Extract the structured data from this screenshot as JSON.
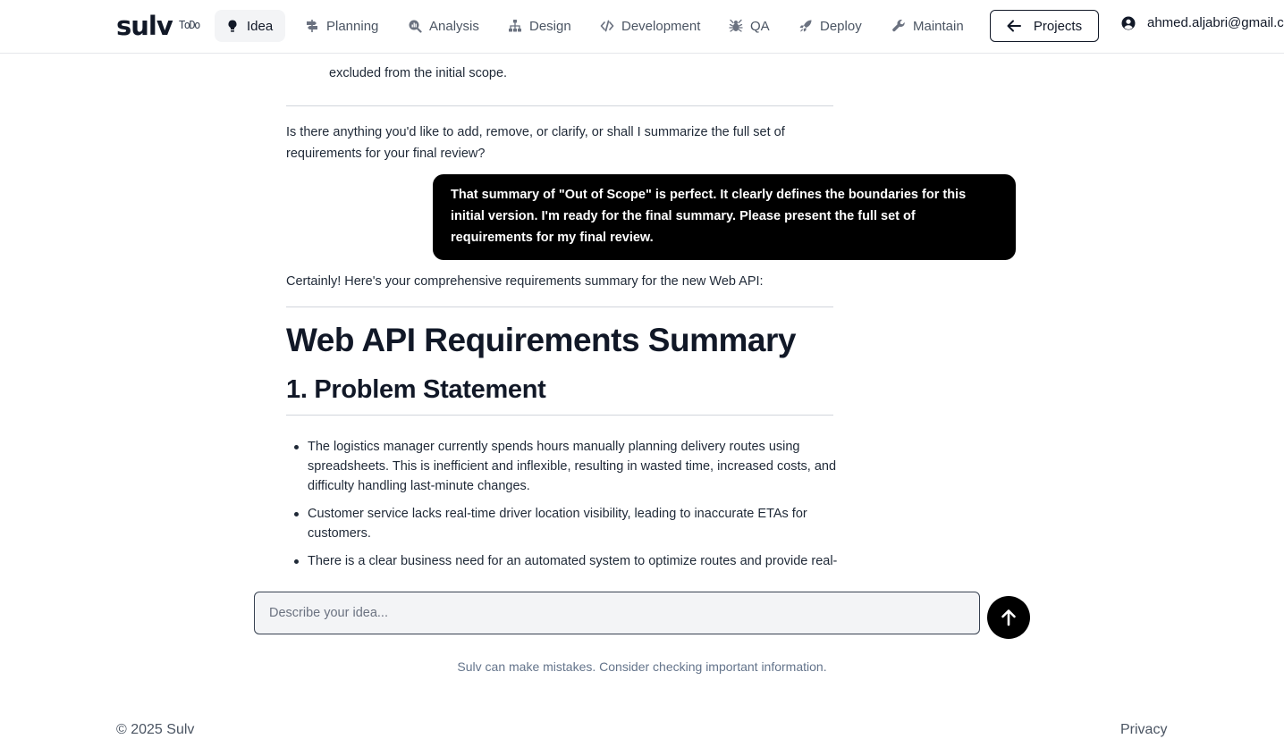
{
  "header": {
    "logo": "sulv",
    "todo_label": "ToDo",
    "nav": [
      {
        "label": "Idea",
        "icon": "lightbulb-icon",
        "active": true
      },
      {
        "label": "Planning",
        "icon": "signpost-icon",
        "active": false
      },
      {
        "label": "Analysis",
        "icon": "magnifier-chart-icon",
        "active": false
      },
      {
        "label": "Design",
        "icon": "sitemap-icon",
        "active": false
      },
      {
        "label": "Development",
        "icon": "code-icon",
        "active": false
      },
      {
        "label": "QA",
        "icon": "bug-icon",
        "active": false
      },
      {
        "label": "Deploy",
        "icon": "rocket-icon",
        "active": false
      },
      {
        "label": "Maintain",
        "icon": "wrench-icon",
        "active": false
      }
    ],
    "projects_button": "Projects",
    "user_email": "ahmed.aljabri@gmail.com"
  },
  "chat": {
    "excluded_text": "excluded from the initial scope.",
    "assistant_question": "Is there anything you'd like to add, remove, or clarify, or shall I summarize the full set of requirements for your final review?",
    "user_message": "That summary of \"Out of Scope\" is perfect. It clearly defines the boundaries for this initial version. I'm ready for the final summary. Please present the full set of requirements for my final review.",
    "assistant_intro": "Certainly! Here's your comprehensive requirements summary for the new Web API:",
    "doc_title": "Web API Requirements Summary",
    "section_heading": "1. Problem Statement",
    "bullets": [
      "The logistics manager currently spends hours manually planning delivery routes using spreadsheets. This is inefficient and inflexible, resulting in wasted time, increased costs, and difficulty handling last-minute changes.",
      "Customer service lacks real-time driver location visibility, leading to inaccurate ETAs for customers.",
      "There is a clear business need for an automated system to optimize routes and provide real-time tracking."
    ]
  },
  "composer": {
    "placeholder": "Describe your idea...",
    "send_icon": "arrow-up-icon"
  },
  "disclaimer": "Sulv can make mistakes. Consider checking important information.",
  "footer": {
    "copyright": "© 2025 Sulv",
    "privacy": "Privacy"
  }
}
